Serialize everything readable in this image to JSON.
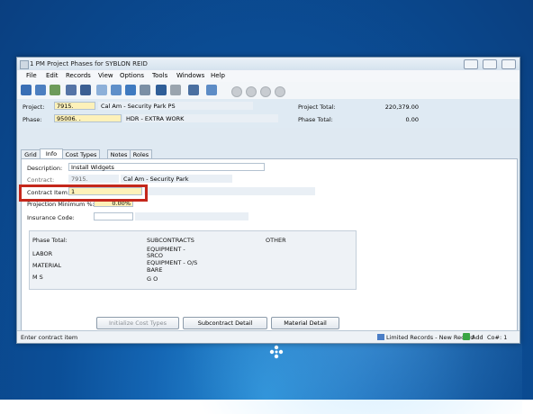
{
  "window": {
    "title": "1 PM Project Phases for SYBLON REID"
  },
  "menu": [
    "File",
    "Edit",
    "Records",
    "View",
    "Options",
    "Tools",
    "Windows",
    "Help"
  ],
  "header": {
    "project_label": "Project:",
    "project_value": "7915.",
    "project_desc": "Cal Am - Security Park PS",
    "phase_label": "Phase:",
    "phase_value": "95006.  .",
    "phase_desc": "HDR - EXTRA WORK",
    "project_total_label": "Project Total:",
    "project_total_value": "220,379.00",
    "phase_total_label": "Phase Total:",
    "phase_total_value": "0.00"
  },
  "tabs": [
    "Grid",
    "Info",
    "Cost Types",
    "Notes",
    "Roles"
  ],
  "active_tab": "Info",
  "info": {
    "description_label": "Description:",
    "description_value": "Install Widgets",
    "contract_label": "Contract:",
    "contract_value": "7915.",
    "contract_desc": "Cal Am - Security Park",
    "contract_item_label": "Contract Item:",
    "contract_item_value": "1",
    "projection_label": "Projection Minimum %:",
    "projection_value": "0.00%",
    "insurance_label": "Insurance Code:",
    "insurance_value": ""
  },
  "summary": {
    "phase_total": "Phase Total:",
    "labor": "LABOR",
    "material": "MATERIAL",
    "ms": "M  S",
    "subcontracts": "SUBCONTRACTS",
    "equipment_srco": "EQUIPMENT -",
    "srco": "SRCO",
    "equipment_os": "EQUIPMENT - O/S",
    "bare": "BARE",
    "go": "G  O",
    "other": "OTHER"
  },
  "buttons": {
    "initialize": "Initialize Cost Types",
    "subcontract": "Subcontract Detail",
    "material": "Material Detail"
  },
  "status": {
    "message": "Enter contract item",
    "records": "Limited Records - New Record",
    "add": "Add",
    "company": "Co#: 1"
  }
}
